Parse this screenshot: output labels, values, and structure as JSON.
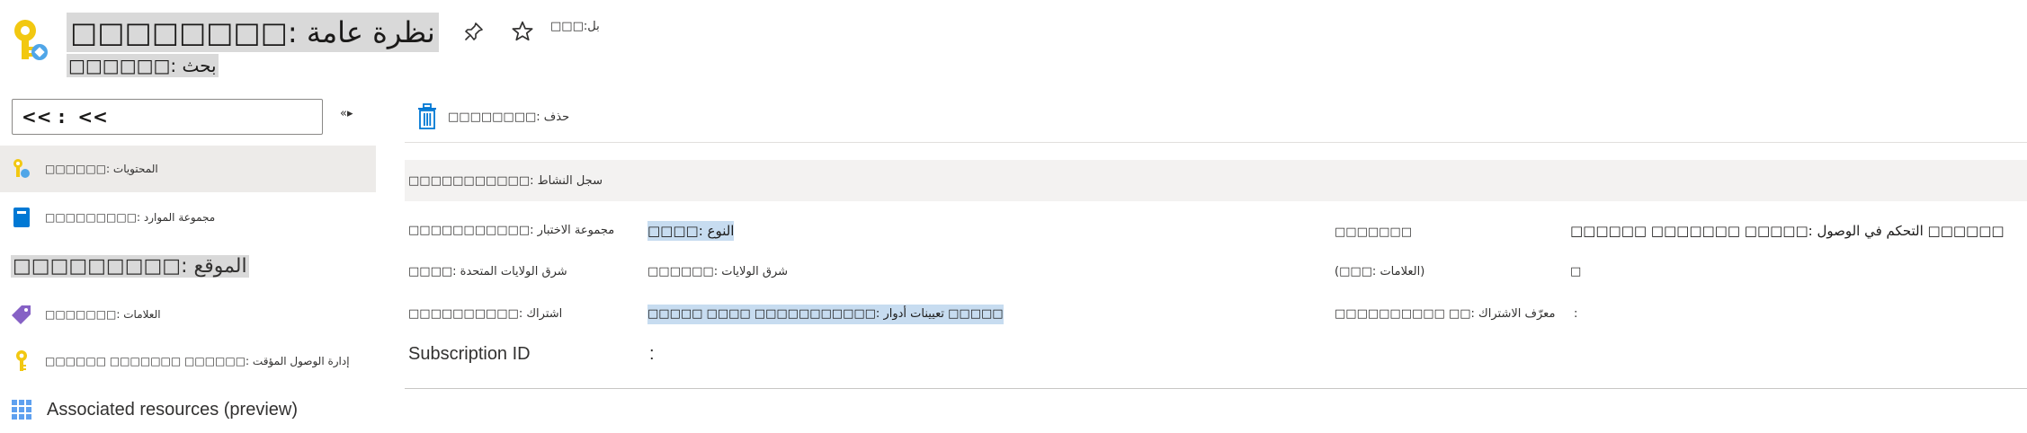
{
  "header": {
    "title": "□□□□□□□□: نظرة عامة",
    "subtitle": "□□□□□□: بحث",
    "more_label": "□□□:بل"
  },
  "sidebar": {
    "search_value": "<< :  <<",
    "collapse_label": "«▸",
    "items": [
      {
        "label": "□□□□□□: المحتويات",
        "icon": "key-vault-icon"
      },
      {
        "label": "□□□□□□□□□: مجموعة الموارد",
        "icon": "book-icon"
      },
      {
        "label": "□□□□□□□□□: الموقع",
        "icon": ""
      },
      {
        "label": "□□□□□□□: العلامات",
        "icon": "tag-icon"
      },
      {
        "label": "□□□□□□ □□□□□□□ □□□□□□: إدارة الوصول المؤقت",
        "icon": "key-icon"
      },
      {
        "label": "Associated resources (preview)",
        "icon": "grid-icon"
      }
    ]
  },
  "toolbar": {
    "delete_label": "□□□□□□□□: حذف"
  },
  "essentials": {
    "label": "□□□□□□□□□□□: سجل النشاط"
  },
  "properties": {
    "resource_group_label": "□□□□□□□□□□□: مجموعة الاختبار",
    "type_value": "□□□□: النوع",
    "right_label_1": "□□□□□□□",
    "access_control_value": "□□□□□□ □□□□□□□ □□□□□: التحكم في الوصول □□□□□□",
    "location_label": "□□□□: شرق الولايات المتحدة",
    "location_value": "□□□□□□: شرق الولايات",
    "tags_label": "(□□□: العلامات)",
    "tags_value": "□",
    "subscription_label": "□□□□□□□□□□: اشتراك",
    "role_assignments_value": "□□□□□ □□□□ □□□□□□□□□□□: تعيينات أدوار □□□□□",
    "subscription_id_short_label": "□□□□□□□□□□ □□: معرّف الاشتراك",
    "subscription_id_short_value": ":",
    "subscription_id_label": "Subscription ID",
    "subscription_id_value": ":"
  }
}
